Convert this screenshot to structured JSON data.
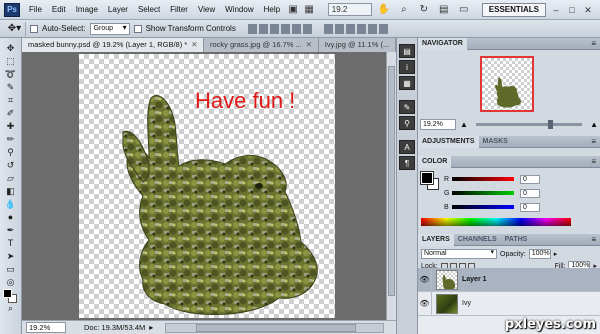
{
  "app": {
    "logo": "Ps"
  },
  "menu": {
    "items": [
      "File",
      "Edit",
      "Image",
      "Layer",
      "Select",
      "Filter",
      "View",
      "Window",
      "Help"
    ],
    "zoom": "19.2",
    "workspace": "ESSENTIALS"
  },
  "options_bar": {
    "auto_select_label": "Auto-Select:",
    "auto_select_value": "Group",
    "show_transform_label": "Show Transform Controls"
  },
  "tabs": [
    {
      "label": "masked bunny.psd @ 19.2% (Layer 1, RGB/8) *",
      "active": true
    },
    {
      "label": "rocky grass.jpg @ 16.7% ...",
      "active": false
    },
    {
      "label": "Ivy.jpg @ 11.1% (...",
      "active": false
    }
  ],
  "canvas": {
    "text": "Have fun !",
    "text_color": "#e01818"
  },
  "status": {
    "zoom": "19.2%",
    "doc": "Doc: 19.3M/53.4M"
  },
  "panels": {
    "navigator": {
      "title": "NAVIGATOR",
      "zoom": "19.2%"
    },
    "adjustments": {
      "title": "ADJUSTMENTS",
      "masks": "MASKS"
    },
    "color": {
      "title": "COLOR",
      "r_label": "R",
      "g_label": "G",
      "b_label": "B",
      "r_value": "0",
      "g_value": "0",
      "b_value": "0"
    },
    "layers": {
      "title": "LAYERS",
      "channels": "CHANNELS",
      "paths": "PATHS",
      "blend_mode": "Normal",
      "opacity_label": "Opacity:",
      "opacity_value": "100%",
      "lock_label": "Lock:",
      "fill_label": "Fill:",
      "fill_value": "100%",
      "list": [
        {
          "name": "Layer 1",
          "active": true
        },
        {
          "name": "Ivy",
          "active": false
        }
      ]
    }
  },
  "watermark": "pxleyes.com"
}
